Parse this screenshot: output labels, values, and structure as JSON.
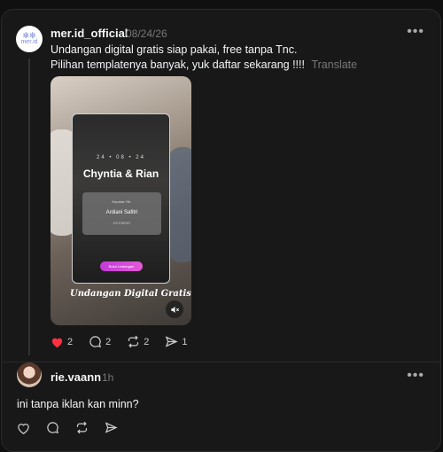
{
  "post": {
    "username": "mer.id_official",
    "date": "08/24/26",
    "avatar_text_top": "✻✻",
    "avatar_text_bottom": "mer.id",
    "line1": "Undangan digital gratis siap pakai, free tanpa Tnc.",
    "line2": "Pilihan templatenya banyak, yuk daftar sekarang !!!!",
    "translate": "Translate",
    "more": "•••",
    "media": {
      "date": "24 • 08 • 24",
      "title": "Chyntia & Rian",
      "box_label": "Kepada Yth.",
      "box_name": "Ardiani Safitri",
      "box_sub": "DITEMPAT",
      "button": "Buka Undangan",
      "caption": "Undangan Digital Gratis"
    },
    "likes": "2",
    "comments": "2",
    "reposts": "2",
    "shares": "1",
    "like_color": "#ff3040"
  },
  "reply": {
    "username": "rie.vaann",
    "time": "1h",
    "text": "ini tanpa iklan kan minn?",
    "more": "•••"
  }
}
